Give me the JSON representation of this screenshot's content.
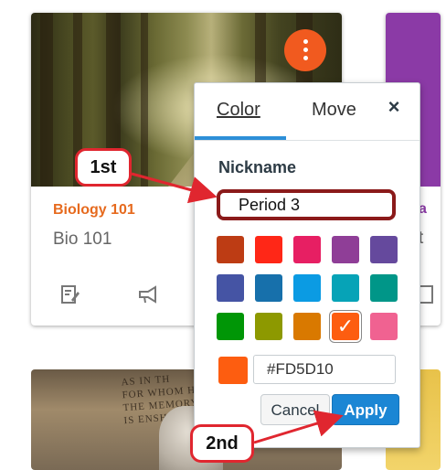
{
  "course_card": {
    "name": "Biology 101",
    "code": "Bio 101",
    "name_color": "#e66a1e",
    "icons": [
      "assignments-icon",
      "announcements-icon"
    ]
  },
  "second_card": {
    "partial_text_top": "a",
    "partial_text_bottom": "t",
    "color": "#8b3aa6"
  },
  "memorial_card": {
    "inscription_lines": [
      "AS IN TH",
      "FOR WHOM H",
      "THE MEMORY O",
      "IS ENSH"
    ]
  },
  "kebab_button": {
    "label": "Course card options",
    "color": "#f15a1f"
  },
  "popover": {
    "tabs": [
      {
        "label": "Color",
        "active": true
      },
      {
        "label": "Move",
        "active": false
      }
    ],
    "close_label": "×",
    "nickname_label": "Nickname",
    "nickname_value": "Period 3",
    "swatches": [
      "#bd3c14",
      "#ff2717",
      "#e71f63",
      "#8f3e97",
      "#65499d",
      "#4554a4",
      "#1770ab",
      "#0b9be3",
      "#06a3b7",
      "#009688",
      "#009606",
      "#8d9900",
      "#d97900",
      "#fd5d10",
      "#f06291"
    ],
    "selected_swatch_index": 13,
    "hex_value": "#FD5D10",
    "hex_preview_color": "#FD5D10",
    "cancel_label": "Cancel",
    "apply_label": "Apply"
  },
  "annotations": {
    "step1": "1st",
    "step2": "2nd",
    "color": "#e0262f"
  }
}
